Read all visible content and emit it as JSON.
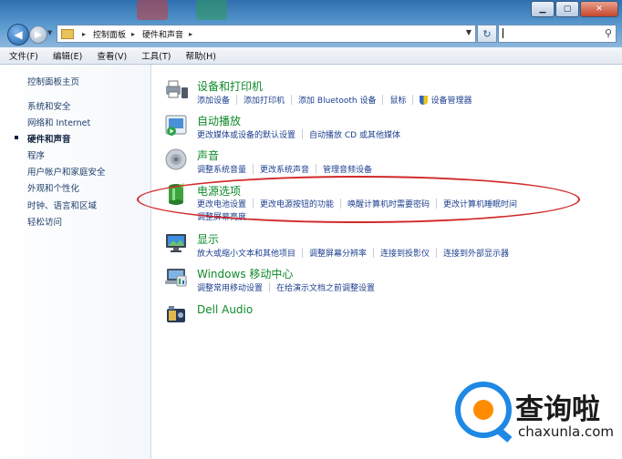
{
  "address_bar": {
    "breadcrumbs": [
      "控制面板",
      "硬件和声音"
    ]
  },
  "menu": [
    "文件(F)",
    "编辑(E)",
    "查看(V)",
    "工具(T)",
    "帮助(H)"
  ],
  "sidebar": {
    "items": [
      {
        "label": "控制面板主页",
        "active": false
      },
      {
        "label": "系统和安全",
        "active": false
      },
      {
        "label": "网络和 Internet",
        "active": false
      },
      {
        "label": "硬件和声音",
        "active": true
      },
      {
        "label": "程序",
        "active": false
      },
      {
        "label": "用户帐户和家庭安全",
        "active": false
      },
      {
        "label": "外观和个性化",
        "active": false
      },
      {
        "label": "时钟、语言和区域",
        "active": false
      },
      {
        "label": "轻松访问",
        "active": false
      }
    ]
  },
  "categories": [
    {
      "title": "设备和打印机",
      "icon": "printer-icon",
      "links": [
        "添加设备",
        "添加打印机",
        "添加 Bluetooth 设备",
        "鼠标",
        "设备管理器"
      ]
    },
    {
      "title": "自动播放",
      "icon": "autoplay-icon",
      "links": [
        "更改媒体或设备的默认设置",
        "自动播放 CD 或其他媒体"
      ]
    },
    {
      "title": "声音",
      "icon": "speaker-icon",
      "links": [
        "调整系统音量",
        "更改系统声音",
        "管理音频设备"
      ]
    },
    {
      "title": "电源选项",
      "icon": "battery-icon",
      "links": [
        "更改电池设置",
        "更改电源按钮的功能",
        "唤醒计算机时需要密码",
        "更改计算机睡眠时间",
        "调整屏幕亮度"
      ]
    },
    {
      "title": "显示",
      "icon": "display-icon",
      "links": [
        "放大或缩小文本和其他项目",
        "调整屏幕分辨率",
        "连接到投影仪",
        "连接到外部显示器"
      ]
    },
    {
      "title": "Windows 移动中心",
      "icon": "mobility-center-icon",
      "links": [
        "调整常用移动设置",
        "在给演示文档之前调整设置"
      ]
    },
    {
      "title": "Dell Audio",
      "icon": "dell-audio-icon",
      "links": []
    }
  ],
  "annotation_color": "#d22a2a",
  "watermark": {
    "brand": "查询啦",
    "url": "chaxunla.com"
  }
}
